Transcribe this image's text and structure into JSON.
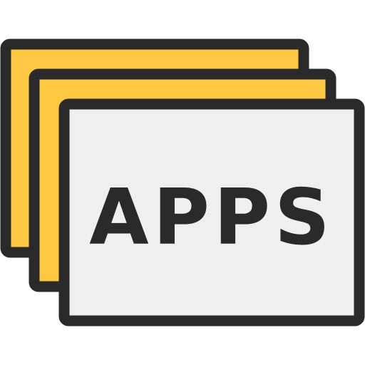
{
  "icon": {
    "label": "APPS",
    "name": "apps-stack-icon"
  },
  "colors": {
    "outline": "#2b2a2a",
    "back_card_fill": "#ffc843",
    "front_card_fill": "#efefef"
  }
}
